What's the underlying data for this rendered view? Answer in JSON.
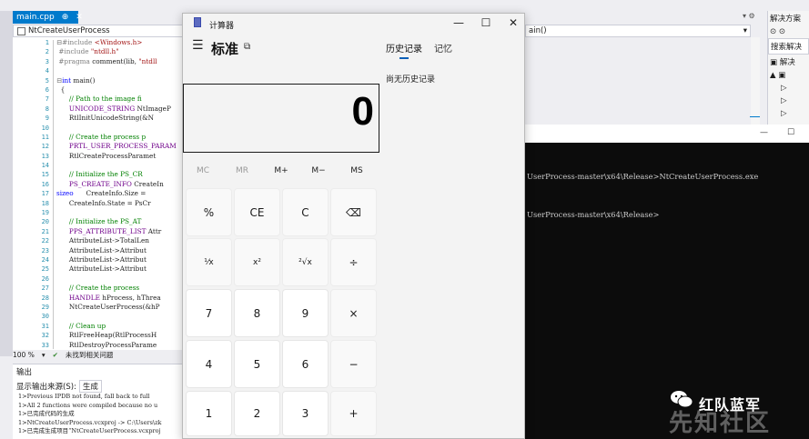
{
  "vs": {
    "file_tab": "main.cpp",
    "tab_pin": "⊕",
    "tab_close": "✕",
    "nav_left": "NtCreateUserProcess",
    "nav_right": "ain()",
    "nav_arrow": "▾",
    "tab_icons": "▾ ⚙",
    "solution": {
      "title": "解决方案",
      "toolbar": "⊙ ⊙",
      "search": "搜索解决",
      "items": [
        "▣ 解决",
        "▲ ▣",
        "▷",
        "▷",
        "▷"
      ]
    },
    "line_numbers": [
      "1",
      "2",
      "3",
      "4",
      "5",
      "6",
      "7",
      "8",
      "9",
      "10",
      "11",
      "12",
      "13",
      "14",
      "15",
      "16",
      "17",
      "18",
      "19",
      "20",
      "21",
      "22",
      "23",
      "24",
      "25",
      "26",
      "27",
      "28",
      "29",
      "30",
      "31",
      "32",
      "33"
    ],
    "code": [
      {
        "pp": "⊟#include ",
        "str": "<Windows.h>"
      },
      {
        "pp": " #include ",
        "str": "\"ntdll.h\""
      },
      {
        "pp": " #pragma ",
        "txt": "comment(lib, ",
        "str": "\"ntdll"
      },
      {
        "txt": ""
      },
      {
        "pp": "⊟",
        "kw": "int",
        "txt": " main()"
      },
      {
        "txt": "  {"
      },
      {
        "cm": "      // Path to the image fi"
      },
      {
        "ma": "      UNICODE_STRING",
        "txt": " NtImageP"
      },
      {
        "txt": "      RtlInitUnicodeString(&N"
      },
      {
        "txt": ""
      },
      {
        "cm": "      // Create the process p"
      },
      {
        "ma": "      PRTL_USER_PROCESS_PARAM"
      },
      {
        "txt": "      RtlCreateProcessParamet"
      },
      {
        "txt": ""
      },
      {
        "cm": "      // Initialize the PS_CR"
      },
      {
        "ma": "      PS_CREATE_INFO",
        "txt": " CreateIn"
      },
      {
        "txt": "      CreateInfo.Size = ",
        "kw": "sizeo"
      },
      {
        "txt": "      CreateInfo.State = PsCr"
      },
      {
        "txt": ""
      },
      {
        "cm": "      // Initialize the PS_AT"
      },
      {
        "ma": "      PPS_ATTRIBUTE_LIST",
        "txt": " Attr"
      },
      {
        "txt": "      AttributeList->TotalLen"
      },
      {
        "txt": "      AttributeList->Attribut"
      },
      {
        "txt": "      AttributeList->Attribut"
      },
      {
        "txt": "      AttributeList->Attribut"
      },
      {
        "txt": ""
      },
      {
        "cm": "      // Create the process"
      },
      {
        "ma": "      HANDLE",
        "txt": " hProcess, hThrea"
      },
      {
        "txt": "      NtCreateUserProcess(&hP"
      },
      {
        "txt": ""
      },
      {
        "cm": "      // Clean up"
      },
      {
        "txt": "      RtlFreeHeap(RtlProcessH"
      },
      {
        "txt": "      RtlDestroyProcessParame"
      }
    ],
    "status_zoom": "100 %",
    "status_zoom_arrow": "▾",
    "status_ok_icon": "✔",
    "status_msg": "未找到相关问题",
    "output_title": "输出",
    "output_source_label": "显示输出来源(S):",
    "output_source_value": "生成",
    "output_lines": [
      "1>Previous IPDB not found, fall back to full",
      "1>All 2 functions were compiled because no u",
      "1>已完成代码的生成",
      "1>NtCreateUserProcess.vcxproj -> C:\\Users\\zk",
      "1>已完成生成项目“NtCreateUserProcess.vcxproj"
    ]
  },
  "console": {
    "minimize": "—",
    "maximize": "☐",
    "lines": [
      "UserProcess-master\\x64\\Release>NtCreateUserProcess.exe",
      "UserProcess-master\\x64\\Release>"
    ]
  },
  "watermark": {
    "brand": "红队蓝军",
    "background_text": "先知社区"
  },
  "calc": {
    "window_title": "计算器",
    "minimize": "—",
    "maximize": "☐",
    "close": "✕",
    "menu_icon": "☰",
    "mode": "标准",
    "keep_on_top_icon": "⧉",
    "history_tab": "历史记录",
    "memory_tab": "记忆",
    "history_empty": "尚无历史记录",
    "display": "0",
    "memory_buttons": [
      "MC",
      "MR",
      "M+",
      "M−",
      "MS"
    ],
    "keys": [
      [
        "%",
        "CE",
        "C",
        "⌫"
      ],
      [
        "¹⁄x",
        "x²",
        "²√x",
        "÷"
      ],
      [
        "7",
        "8",
        "9",
        "×"
      ],
      [
        "4",
        "5",
        "6",
        "−"
      ],
      [
        "1",
        "2",
        "3",
        "+"
      ]
    ]
  }
}
